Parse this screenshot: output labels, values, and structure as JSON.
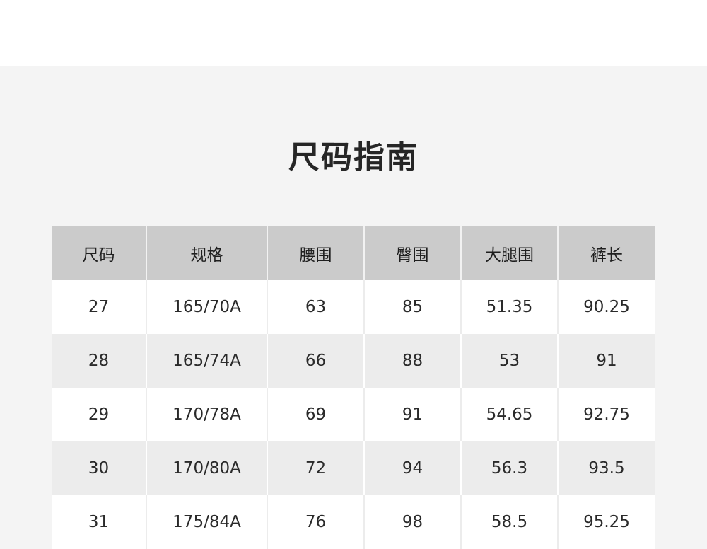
{
  "title": "尺码指南",
  "table": {
    "headers": [
      "尺码",
      "规格",
      "腰围",
      "臀围",
      "大腿围",
      "裤长"
    ],
    "rows": [
      [
        "27",
        "165/70A",
        "63",
        "85",
        "51.35",
        "90.25"
      ],
      [
        "28",
        "165/74A",
        "66",
        "88",
        "53",
        "91"
      ],
      [
        "29",
        "170/78A",
        "69",
        "91",
        "54.65",
        "92.75"
      ],
      [
        "30",
        "170/80A",
        "72",
        "94",
        "56.3",
        "93.5"
      ],
      [
        "31",
        "175/84A",
        "76",
        "98",
        "58.5",
        "95.25"
      ]
    ]
  },
  "colors": {
    "header_bg": "#cbcbcb",
    "row_alt_bg": "#ececec",
    "panel_bg": "#f4f4f4"
  }
}
